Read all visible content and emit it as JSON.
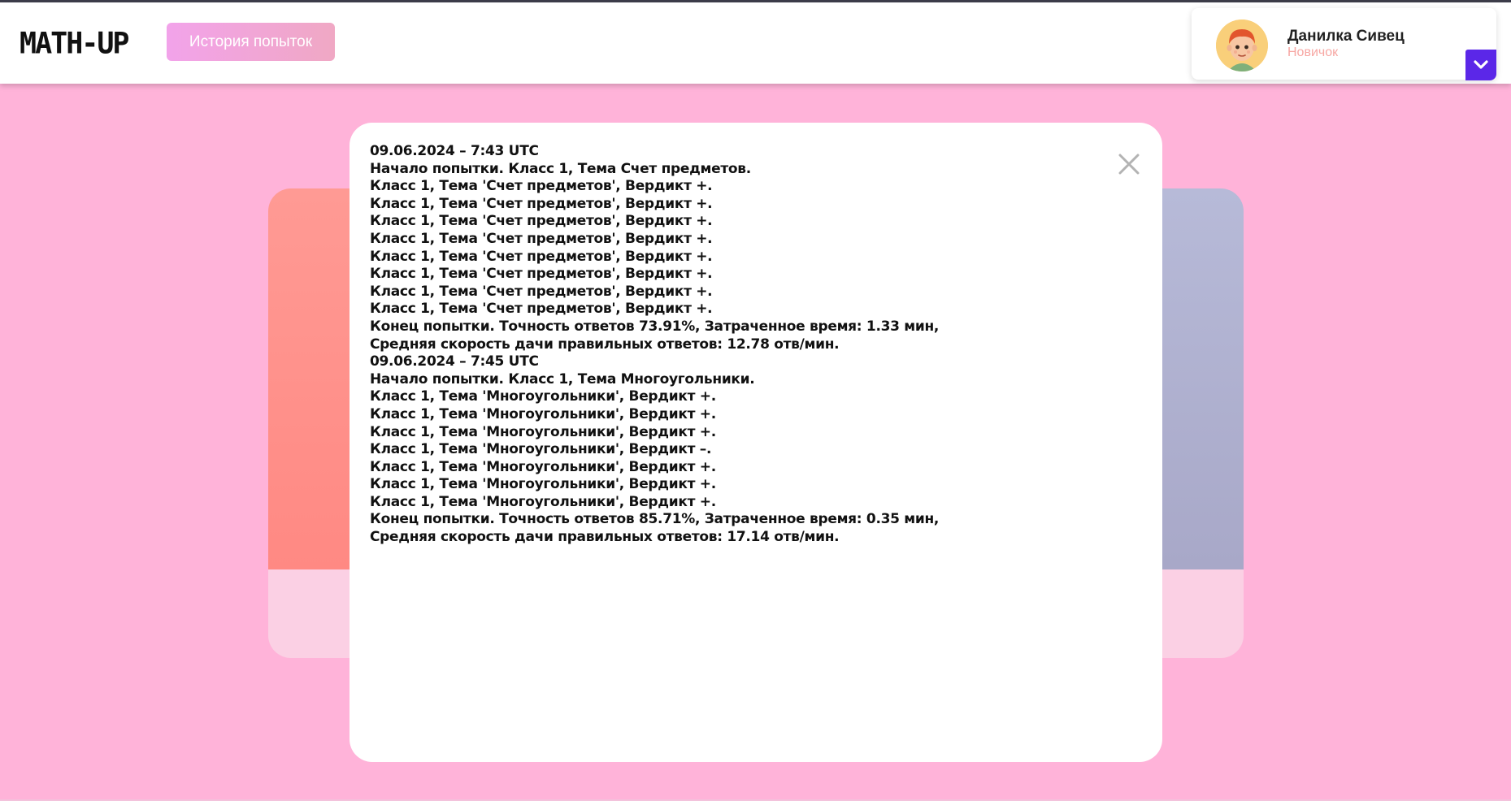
{
  "header": {
    "logo": "MATH-UP",
    "history_button": "История попыток"
  },
  "profile": {
    "name": "Данилка Сивец",
    "rank": "Новичок"
  },
  "modal": {
    "lines": [
      "09.06.2024 – 7:43 UTC",
      "Начало попытки. Класс 1, Тема Счет предметов.",
      "Класс 1, Тема 'Счет предметов', Вердикт +.",
      "Класс 1, Тема 'Счет предметов', Вердикт +.",
      "Класс 1, Тема 'Счет предметов', Вердикт +.",
      "Класс 1, Тема 'Счет предметов', Вердикт +.",
      "Класс 1, Тема 'Счет предметов', Вердикт +.",
      "Класс 1, Тема 'Счет предметов', Вердикт +.",
      "Класс 1, Тема 'Счет предметов', Вердикт +.",
      "Класс 1, Тема 'Счет предметов', Вердикт +.",
      "Конец попытки. Точность ответов 73.91%, Затраченное время: 1.33 мин,",
      "Средняя скорость дачи правильных ответов: 12.78 отв/мин.",
      "09.06.2024 – 7:45 UTC",
      "Начало попытки. Класс 1, Тема Многоугольники.",
      "Класс 1, Тема 'Многоугольники', Вердикт +.",
      "Класс 1, Тема 'Многоугольники', Вердикт +.",
      "Класс 1, Тема 'Многоугольники', Вердикт +.",
      "Класс 1, Тема 'Многоугольники', Вердикт –.",
      "Класс 1, Тема 'Многоугольники', Вердикт +.",
      "Класс 1, Тема 'Многоугольники', Вердикт +.",
      "Класс 1, Тема 'Многоугольники', Вердикт +.",
      "Конец попытки. Точность ответов 85.71%, Затраченное время: 0.35 мин,",
      "Средняя скорость дачи правильных ответов: 17.14 отв/мин."
    ]
  },
  "icons": {
    "close": "close-icon",
    "toggle": "chevron-down-icon",
    "avatar": "avatar"
  },
  "colors": {
    "background": "#ffb3d9",
    "accent": "#5b27e8",
    "button_gradient_start": "#f2a3ea",
    "button_gradient_end": "#f0a8c4",
    "rank": "#f7a7a3"
  }
}
